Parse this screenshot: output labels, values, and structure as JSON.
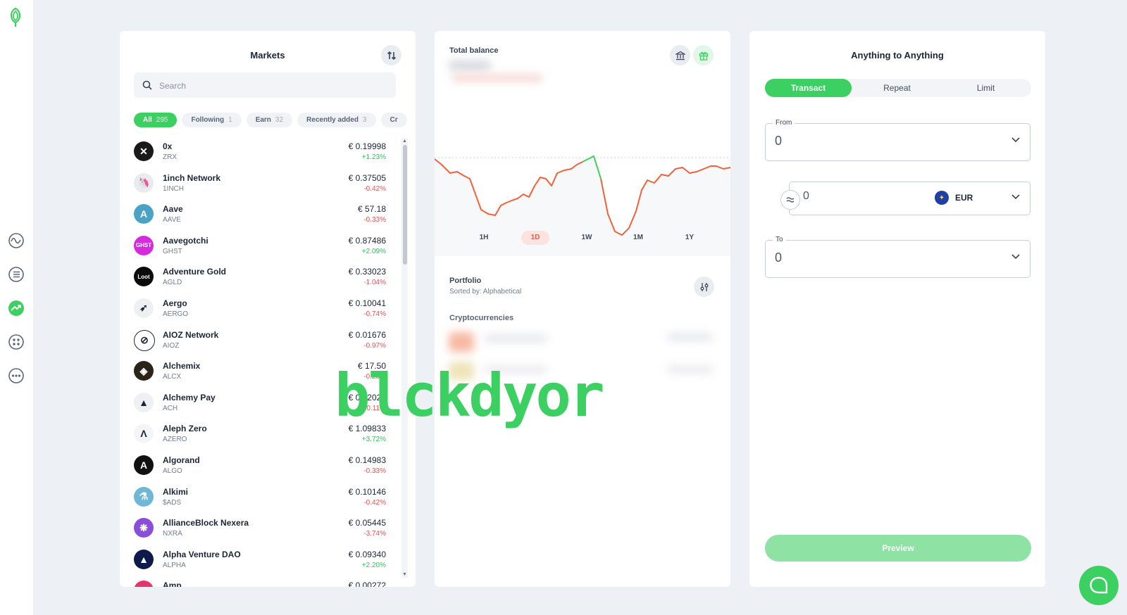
{
  "sidebar": {
    "items": [
      {
        "icon": "pulse-icon"
      },
      {
        "icon": "list-icon"
      },
      {
        "icon": "trending-icon"
      },
      {
        "icon": "apps-icon"
      },
      {
        "icon": "more-icon"
      }
    ]
  },
  "markets": {
    "title": "Markets",
    "search_placeholder": "Search",
    "filters": [
      {
        "label": "All",
        "count": "295",
        "active": true
      },
      {
        "label": "Following",
        "count": "1"
      },
      {
        "label": "Earn",
        "count": "32"
      },
      {
        "label": "Recently added",
        "count": "3"
      },
      {
        "label": "Cr",
        "count": ""
      }
    ],
    "assets": [
      {
        "name": "0x",
        "symbol": "ZRX",
        "price": "€ 0.19998",
        "change": "+1.23%",
        "dir": "pos",
        "color": "#1a1a1a",
        "glyph": "✕"
      },
      {
        "name": "1inch Network",
        "symbol": "1INCH",
        "price": "€ 0.37505",
        "change": "-0.42%",
        "dir": "neg",
        "color": "#e8ebf0",
        "glyph": "🦄"
      },
      {
        "name": "Aave",
        "symbol": "AAVE",
        "price": "€ 57.18",
        "change": "-0.33%",
        "dir": "neg",
        "color": "#4aa3c4",
        "glyph": "A"
      },
      {
        "name": "Aavegotchi",
        "symbol": "GHST",
        "price": "€ 0.87486",
        "change": "+2.09%",
        "dir": "pos",
        "color": "#d629e0",
        "glyph": "GHST"
      },
      {
        "name": "Adventure Gold",
        "symbol": "AGLD",
        "price": "€ 0.33023",
        "change": "-1.04%",
        "dir": "neg",
        "color": "#0b0b0b",
        "glyph": "Loot"
      },
      {
        "name": "Aergo",
        "symbol": "AERGO",
        "price": "€ 0.10041",
        "change": "-0.74%",
        "dir": "neg",
        "color": "#eef0f4",
        "glyph": "➶"
      },
      {
        "name": "AIOZ Network",
        "symbol": "AIOZ",
        "price": "€ 0.01676",
        "change": "-0.97%",
        "dir": "neg",
        "color": "#ffffff",
        "glyph": "⊘"
      },
      {
        "name": "Alchemix",
        "symbol": "ALCX",
        "price": "€ 17.50",
        "change": "-0.28%",
        "dir": "neg",
        "color": "#2b2218",
        "glyph": "◈"
      },
      {
        "name": "Alchemy Pay",
        "symbol": "ACH",
        "price": "€ 0.02029",
        "change": "-0.11%",
        "dir": "neg",
        "color": "#eef0f4",
        "glyph": "▲"
      },
      {
        "name": "Aleph Zero",
        "symbol": "AZERO",
        "price": "€ 1.09833",
        "change": "+3.72%",
        "dir": "pos",
        "color": "#f4f5f7",
        "glyph": "Λ"
      },
      {
        "name": "Algorand",
        "symbol": "ALGO",
        "price": "€ 0.14983",
        "change": "-0.33%",
        "dir": "neg",
        "color": "#111111",
        "glyph": "A"
      },
      {
        "name": "Alkimi",
        "symbol": "$ADS",
        "price": "€ 0.10146",
        "change": "-0.42%",
        "dir": "neg",
        "color": "#6fb7d6",
        "glyph": "⚗"
      },
      {
        "name": "AllianceBlock Nexera",
        "symbol": "NXRA",
        "price": "€ 0.05445",
        "change": "-3.74%",
        "dir": "neg",
        "color": "#8a4fd8",
        "glyph": "❋"
      },
      {
        "name": "Alpha Venture DAO",
        "symbol": "ALPHA",
        "price": "€ 0.09340",
        "change": "+2.20%",
        "dir": "pos",
        "color": "#0d1b4a",
        "glyph": "▲"
      },
      {
        "name": "Amp",
        "symbol": "AMP",
        "price": "€ 0.00272",
        "change": "",
        "dir": "neg",
        "color": "#e8336a",
        "glyph": ""
      }
    ]
  },
  "balance": {
    "title": "Total balance",
    "periods": [
      "1H",
      "1D",
      "1W",
      "1M",
      "1Y"
    ],
    "active_period": "1D",
    "portfolio_title": "Portfolio",
    "portfolio_sort": "Sorted by: Alphabetical",
    "crypto_label": "Cryptocurrencies",
    "line_color": "#f2623a",
    "highlight_color": "#3ccf61"
  },
  "swap": {
    "title": "Anything to Anything",
    "tabs": [
      "Transact",
      "Repeat",
      "Limit"
    ],
    "active_tab": "Transact",
    "from_label": "From",
    "from_value": "0",
    "mid_value": "0",
    "currency": "EUR",
    "to_label": "To",
    "to_value": "0",
    "preview_label": "Preview"
  },
  "overlay_text": "blckdyor",
  "colors": {
    "accent": "#3ccf61",
    "negative": "#ee4f4f",
    "positive": "#31c45a"
  }
}
